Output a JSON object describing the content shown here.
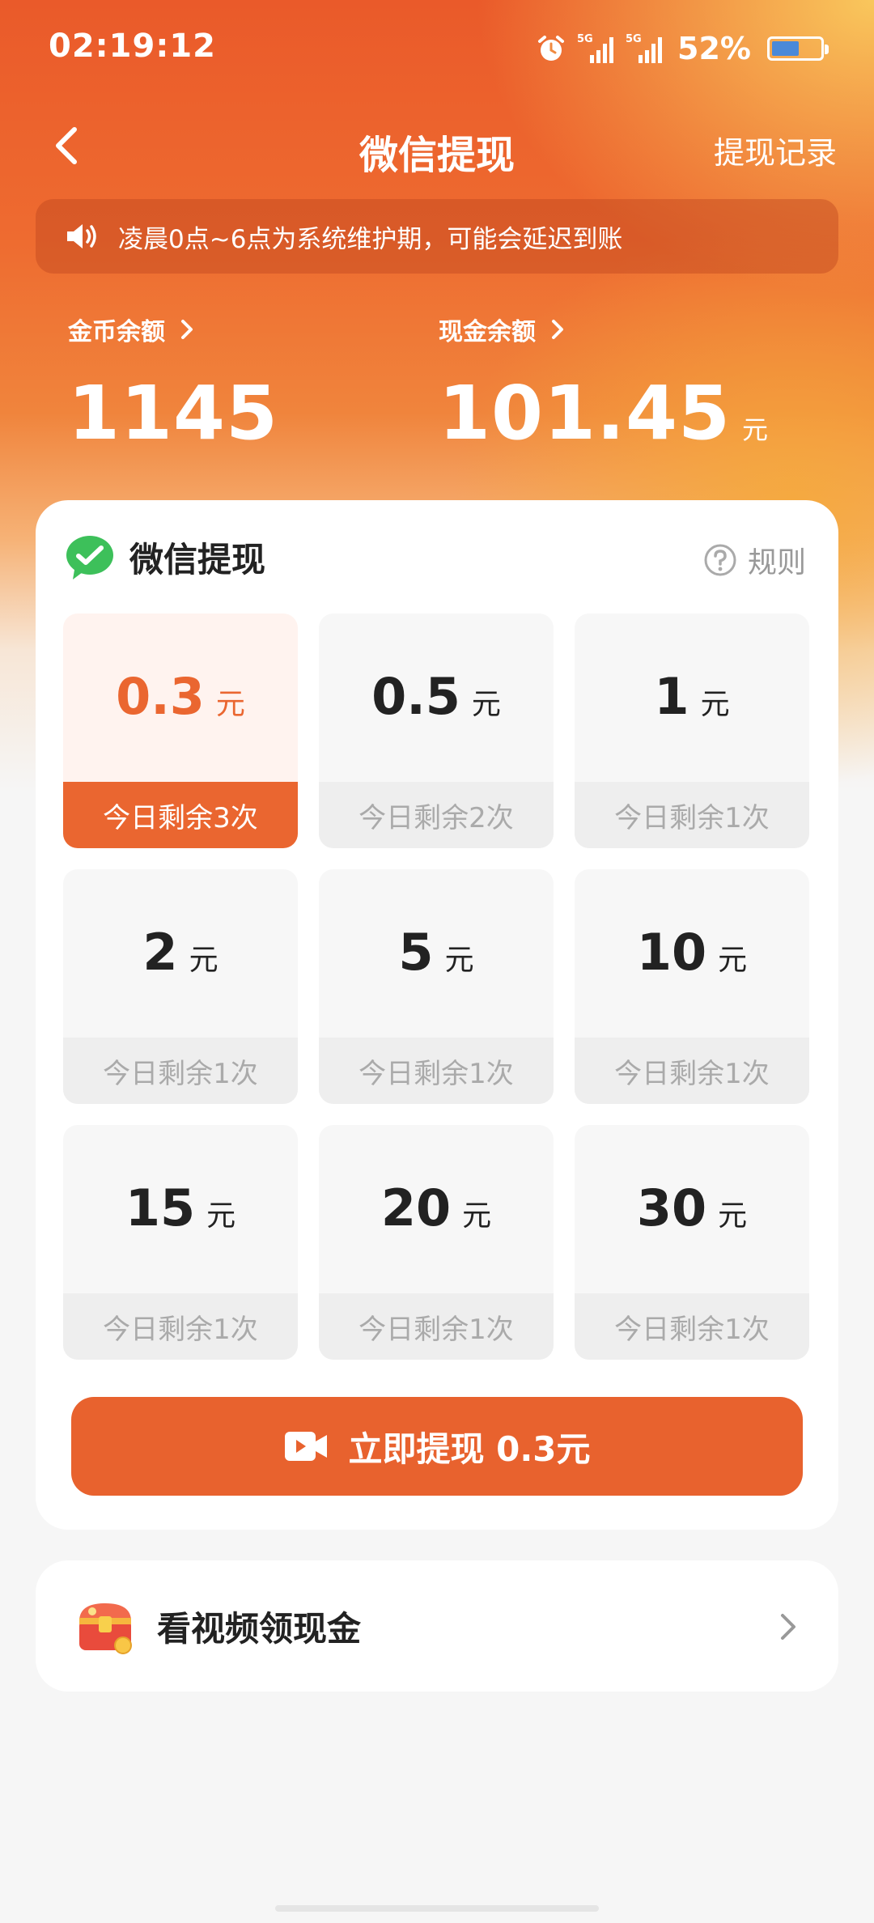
{
  "status_bar": {
    "time": "02:19:12",
    "network1": "5G",
    "network2": "5G",
    "battery": "52%"
  },
  "nav": {
    "title": "微信提现",
    "action": "提现记录"
  },
  "notice": {
    "text": "凌晨0点~6点为系统维护期，可能会延迟到账"
  },
  "balances": {
    "coin_label": "金币余额",
    "coin_value": "1145",
    "cash_label": "现金余额",
    "cash_value": "101.45",
    "cash_unit": "元"
  },
  "withdraw": {
    "title": "微信提现",
    "rules": "规则",
    "options": [
      {
        "amount": "0.3",
        "unit": "元",
        "remaining": "今日剩余3次",
        "selected": true
      },
      {
        "amount": "0.5",
        "unit": "元",
        "remaining": "今日剩余2次"
      },
      {
        "amount": "1",
        "unit": "元",
        "remaining": "今日剩余1次"
      },
      {
        "amount": "2",
        "unit": "元",
        "remaining": "今日剩余1次"
      },
      {
        "amount": "5",
        "unit": "元",
        "remaining": "今日剩余1次"
      },
      {
        "amount": "10",
        "unit": "元",
        "remaining": "今日剩余1次"
      },
      {
        "amount": "15",
        "unit": "元",
        "remaining": "今日剩余1次"
      },
      {
        "amount": "20",
        "unit": "元",
        "remaining": "今日剩余1次"
      },
      {
        "amount": "30",
        "unit": "元",
        "remaining": "今日剩余1次"
      }
    ],
    "button_label": "立即提现 0.3元"
  },
  "video_task": {
    "label": "看视频领现金"
  },
  "colors": {
    "accent": "#e8622e",
    "wechat_green": "#3dc05a"
  }
}
